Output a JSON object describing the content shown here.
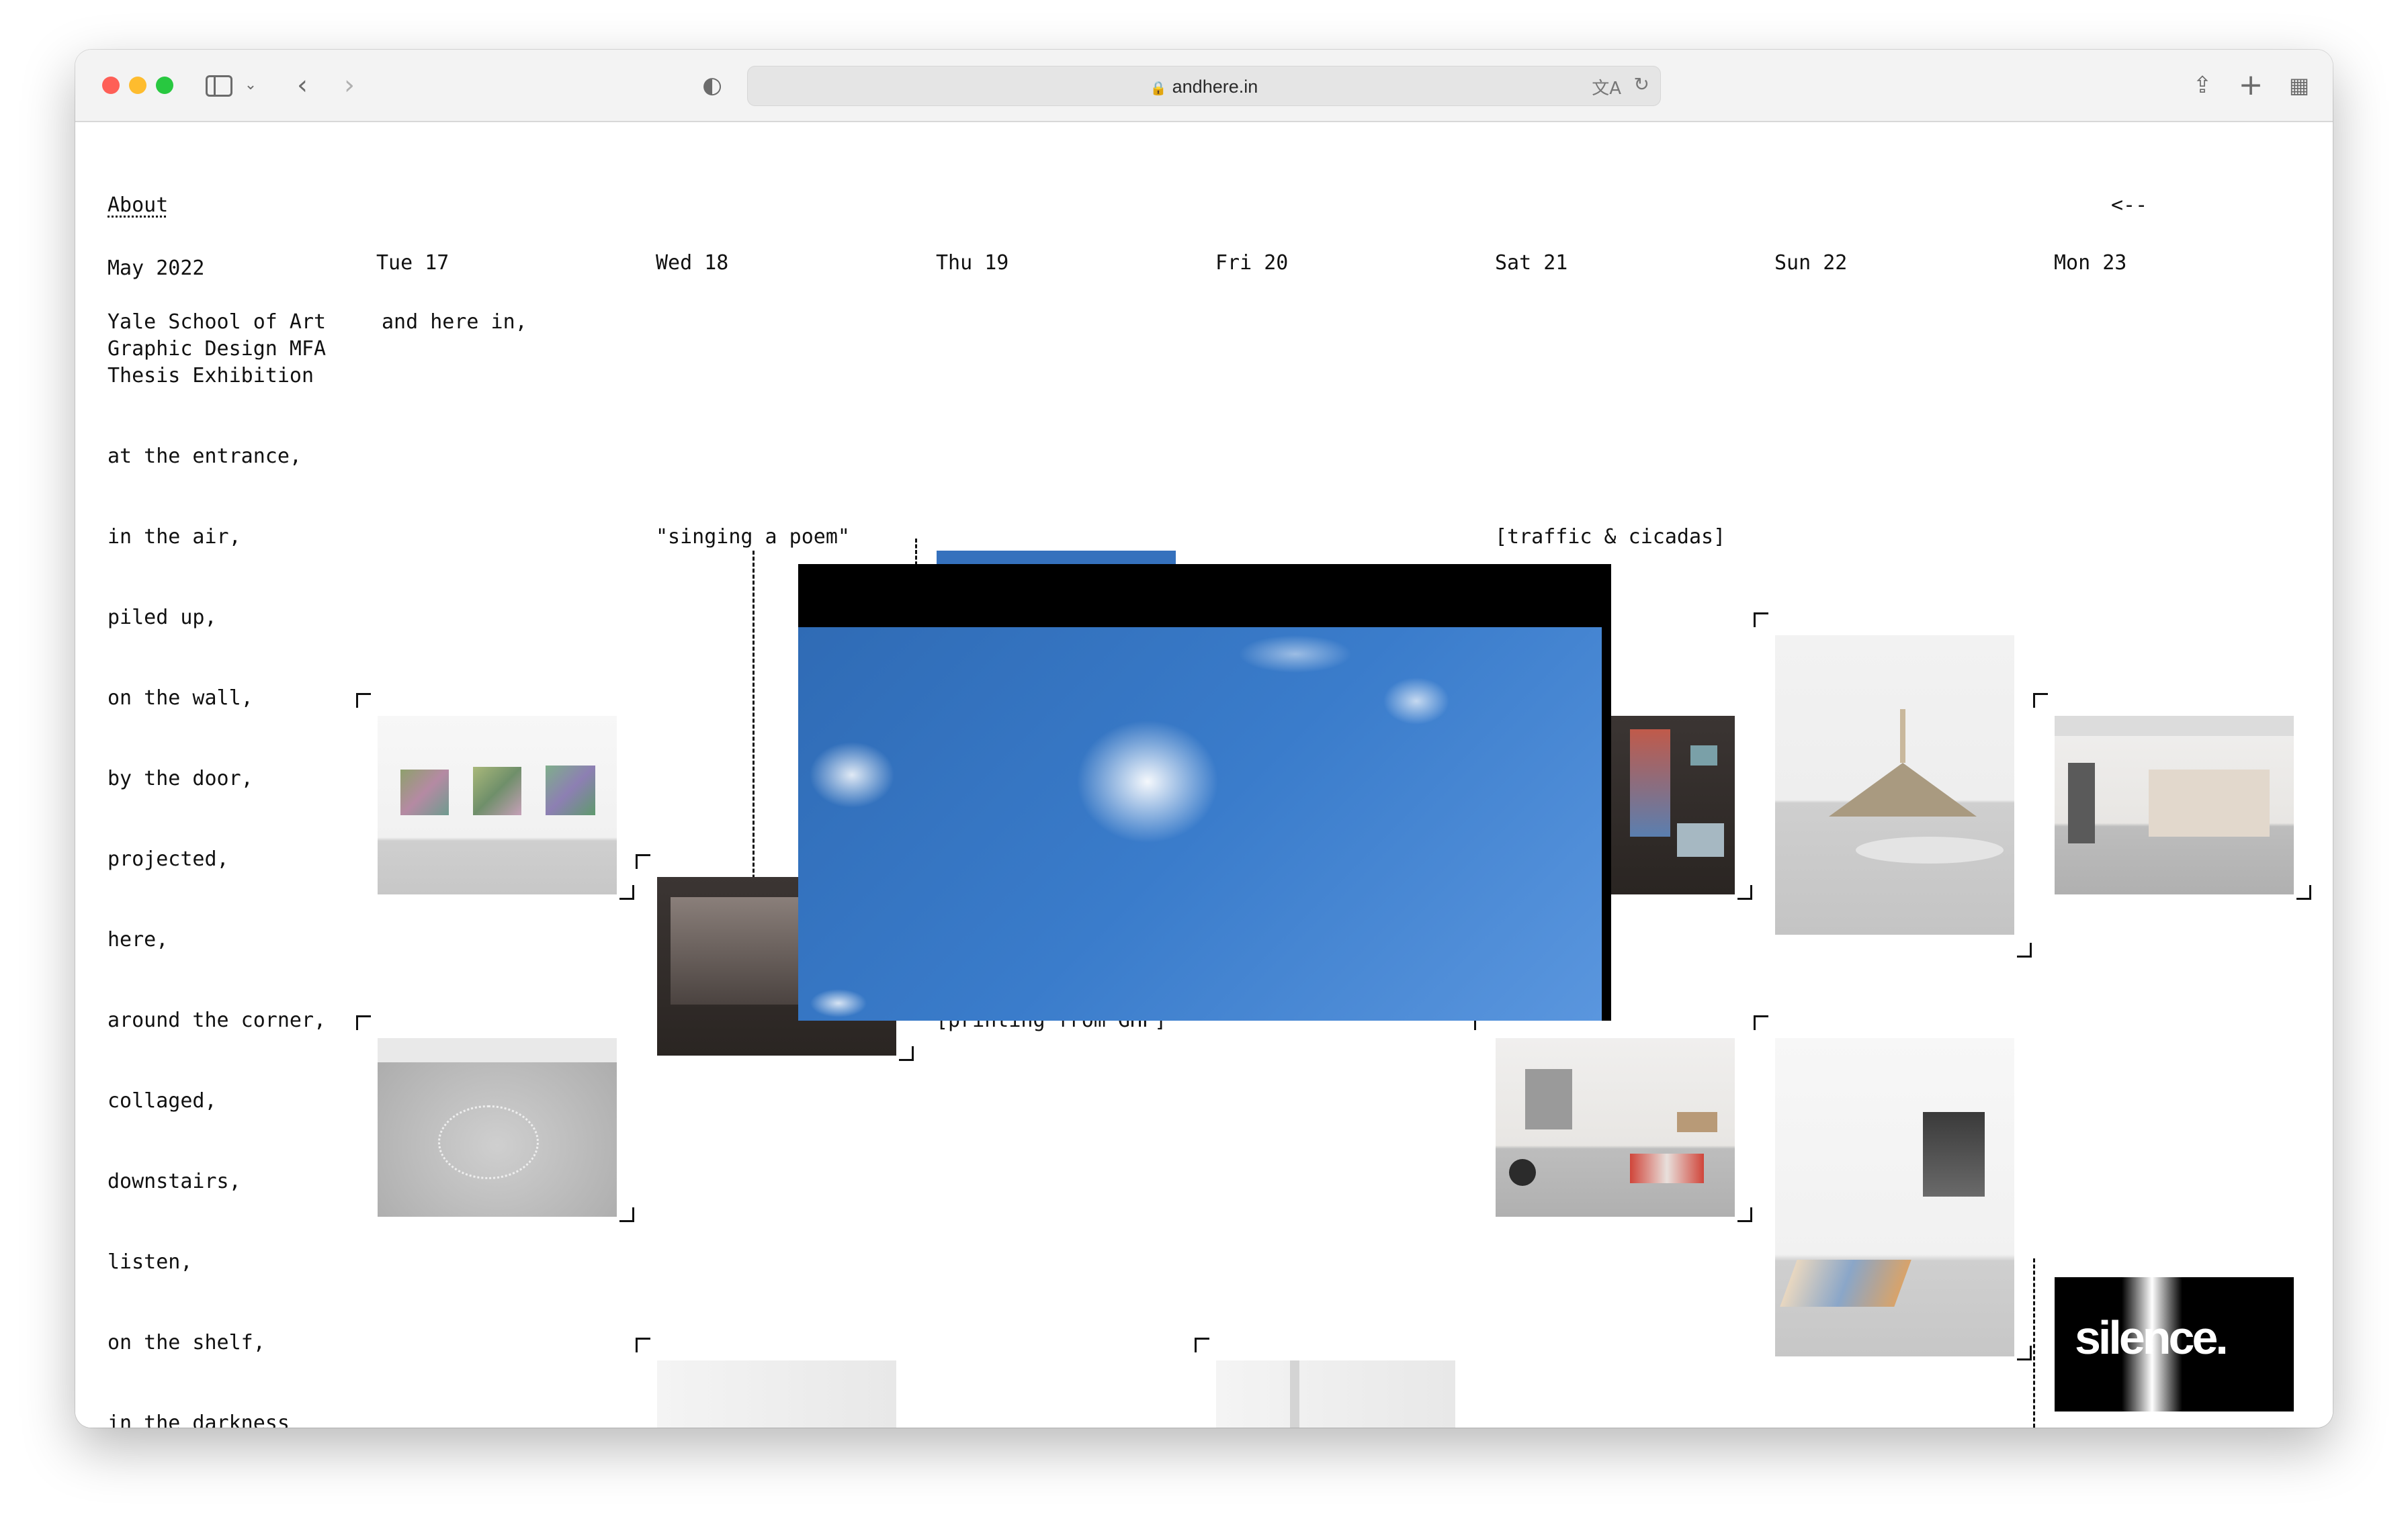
{
  "browser": {
    "url": "andhere.in",
    "icons": {
      "sidebar": "sidebar-icon",
      "back": "chevron-left-icon",
      "forward": "chevron-right-icon",
      "shield": "shield-icon",
      "lock": "lock-icon",
      "translate": "translate-icon",
      "reload": "reload-icon",
      "share": "share-icon",
      "new_tab": "plus-icon",
      "tabs": "tab-overview-icon"
    }
  },
  "nav": {
    "about": "About",
    "back_arrow": "<--"
  },
  "header": {
    "month": "May 2022",
    "days": [
      "Tue 17",
      "Wed 18",
      "Thu 19",
      "Fri 20",
      "Sat 21",
      "Sun 22",
      "Mon 23"
    ]
  },
  "intro": {
    "line1": "Yale School of Art",
    "line2": "Graphic Design MFA",
    "line3": "Thesis Exhibition",
    "tagline": "and here in,"
  },
  "locations": [
    "at the entrance,",
    "in the air,",
    "piled up,",
    "on the wall,",
    "by the door,",
    "projected,",
    "here,",
    "around the corner,",
    "collaged,",
    "downstairs,",
    "listen,",
    "on the shelf,",
    "in the darkness"
  ],
  "captions": {
    "singing": "\"singing a poem\"",
    "traffic": "[traffic & cicadas]",
    "printing": "[printing from GHP]"
  },
  "silence_image_text": "silence."
}
